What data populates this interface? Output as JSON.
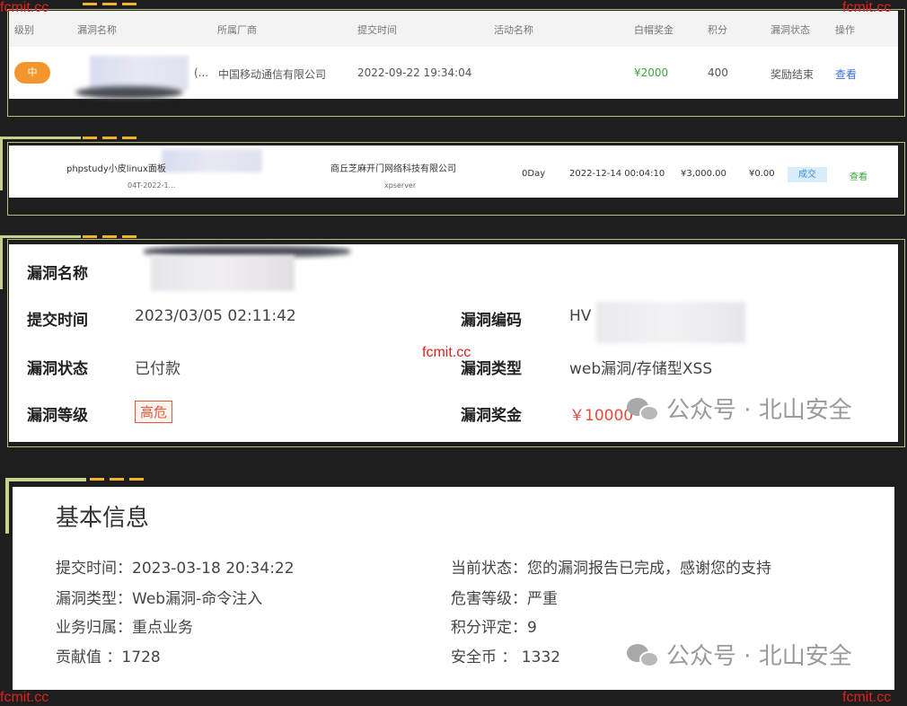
{
  "watermarks": {
    "top_left": "fcmit.cc",
    "top_right": "fcmit.cc",
    "center": "fcmit.cc",
    "bottom_left": "fcmit.cc",
    "bottom_right": "fcmit.cc"
  },
  "wechat_mark": "公众号 · 北山安全",
  "panel1": {
    "headers": [
      "级别",
      "漏洞名称",
      "所属厂商",
      "提交时间",
      "活动名称",
      "白帽奖金",
      "积分",
      "漏洞状态",
      "操作"
    ],
    "row": {
      "level": "中",
      "name_suffix": "(...",
      "vendor": "中国移动通信有限公司",
      "submit_time": "2022-09-22 19:34:04",
      "bounty": "¥2000",
      "points": "400",
      "status": "奖励结束",
      "action": "查看"
    }
  },
  "panel2": {
    "name": "phpstudy小皮linux面板",
    "id": "04T-2022-1...",
    "vendor": "商丘芝麻开门网络科技有限公司",
    "product": "xpserver",
    "type": "0Day",
    "time": "2022-12-14 00:04:10",
    "amount": "¥3,000.00",
    "amount2": "¥0.00",
    "status": "成交",
    "action": "查看"
  },
  "panel3": {
    "name_label": "漏洞名称",
    "submit_label": "提交时间",
    "submit_value": "2023/03/05 02:11:42",
    "code_label": "漏洞编码",
    "code_value": "HV",
    "status_label": "漏洞状态",
    "status_value": "已付款",
    "type_label": "漏洞类型",
    "type_value": "web漏洞/存储型XSS",
    "level_label": "漏洞等级",
    "level_value": "高危",
    "reward_label": "漏洞奖金",
    "reward_value": "￥10000"
  },
  "panel4": {
    "title": "基本信息",
    "submit": "提交时间：2023-03-18 20:34:22",
    "type": "漏洞类型：Web漏洞-命令注入",
    "business": "业务归属：重点业务",
    "contribution": "贡献值  ：1728",
    "current_status": "当前状态：您的漏洞报告已完成，感谢您的支持",
    "severity": "危害等级：严重",
    "score": "积分评定：9",
    "coins": "安全币  ：  1332"
  }
}
